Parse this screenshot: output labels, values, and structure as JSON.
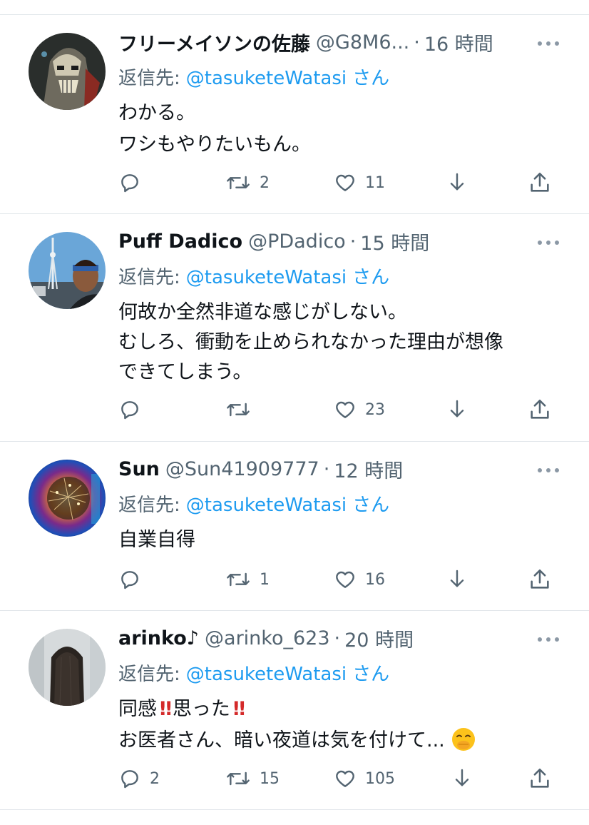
{
  "tweets": [
    {
      "name": "フリーメイソンの佐藤",
      "handle": "@G8M6...",
      "dot": "·",
      "time": "16 時間",
      "reply_label": "返信先:",
      "reply_mention": "@tasuketeWatasi",
      "reply_suffix": "さん",
      "lines": [
        "わかる。",
        "ワシもやりたいもん。"
      ],
      "replies": "",
      "retweets": "2",
      "likes": "11"
    },
    {
      "name": "Puff Dadico",
      "handle": "@PDadico",
      "dot": "·",
      "time": "15 時間",
      "reply_label": "返信先:",
      "reply_mention": "@tasuketeWatasi",
      "reply_suffix": "さん",
      "lines": [
        "何故か全然非道な感じがしない。",
        "むしろ、衝動を止められなかった理由が想像",
        "できてしまう。"
      ],
      "replies": "",
      "retweets": "",
      "likes": "23"
    },
    {
      "name": "Sun",
      "handle": "@Sun41909777",
      "dot": "·",
      "time": "12 時間",
      "reply_label": "返信先:",
      "reply_mention": "@tasuketeWatasi",
      "reply_suffix": "さん",
      "lines": [
        "自業自得"
      ],
      "replies": "",
      "retweets": "1",
      "likes": "16"
    },
    {
      "name": "arinko♪",
      "handle": "@arinko_623",
      "dot": "·",
      "time": "20 時間",
      "reply_label": "返信先:",
      "reply_mention": "@tasuketeWatasi",
      "reply_suffix": "さん",
      "line1_a": "同感",
      "line1_b": "思った",
      "bang": "‼",
      "line2": "お医者さん、暗い夜道は気を付けて...",
      "replies": "2",
      "retweets": "15",
      "likes": "105"
    }
  ],
  "icons": {
    "reply": "reply-icon",
    "retweet": "retweet-icon",
    "like": "heart-icon",
    "bookmark": "arrow-down-icon",
    "share": "share-icon",
    "more": "more-icon",
    "emoji": "hand-over-mouth-emoji"
  },
  "colors": {
    "text": "#0f1419",
    "secondary": "#536471",
    "link": "#1d9bf0",
    "divider": "#e1e6ea"
  }
}
